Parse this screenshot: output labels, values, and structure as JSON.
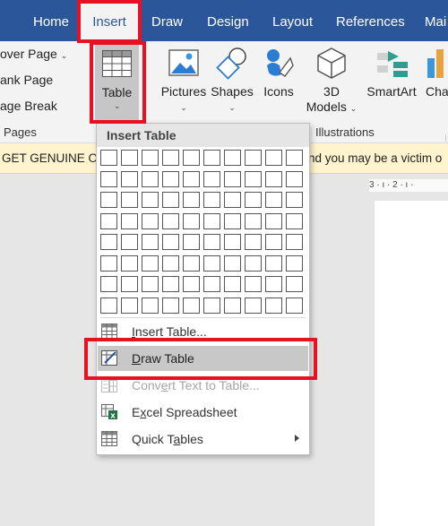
{
  "tabs": [
    "Home",
    "Insert",
    "Draw",
    "Design",
    "Layout",
    "References",
    "Mai"
  ],
  "active_tab": "Insert",
  "pages_group": {
    "items": [
      "over Page",
      "ank Page",
      "age Break"
    ],
    "label": "Pages"
  },
  "table_button": {
    "label": "Table"
  },
  "illustrations": {
    "pictures": "Pictures",
    "shapes": "Shapes",
    "icons": "Icons",
    "models_line1": "3D",
    "models_line2": "Models",
    "smartart": "SmartArt",
    "chart": "Cha",
    "label": "Illustrations"
  },
  "notice": {
    "left": "GET GENUINE O",
    "right": "nd you may be a victim o"
  },
  "ruler": {
    "text": "3 · ı · 2 · ı ·"
  },
  "dropdown": {
    "header": "Insert Table",
    "grid_cols": 10,
    "grid_rows": 8,
    "items": [
      {
        "label": "Insert Table...",
        "disabled": false,
        "submenu": false,
        "icon": "insert-table-icon"
      },
      {
        "label": "Draw Table",
        "disabled": false,
        "submenu": false,
        "icon": "draw-table-icon"
      },
      {
        "label": "Convert Text to Table...",
        "disabled": true,
        "submenu": false,
        "icon": "convert-text-icon"
      },
      {
        "label": "Excel Spreadsheet",
        "disabled": false,
        "submenu": false,
        "icon": "excel-icon"
      },
      {
        "label": "Quick Tables",
        "disabled": false,
        "submenu": true,
        "icon": "quick-tables-icon"
      }
    ]
  },
  "colors": {
    "tab_bar": "#2b579a",
    "highlight_box": "#e81123",
    "notice_bg": "#fff4ce",
    "excel_green": "#217346"
  }
}
